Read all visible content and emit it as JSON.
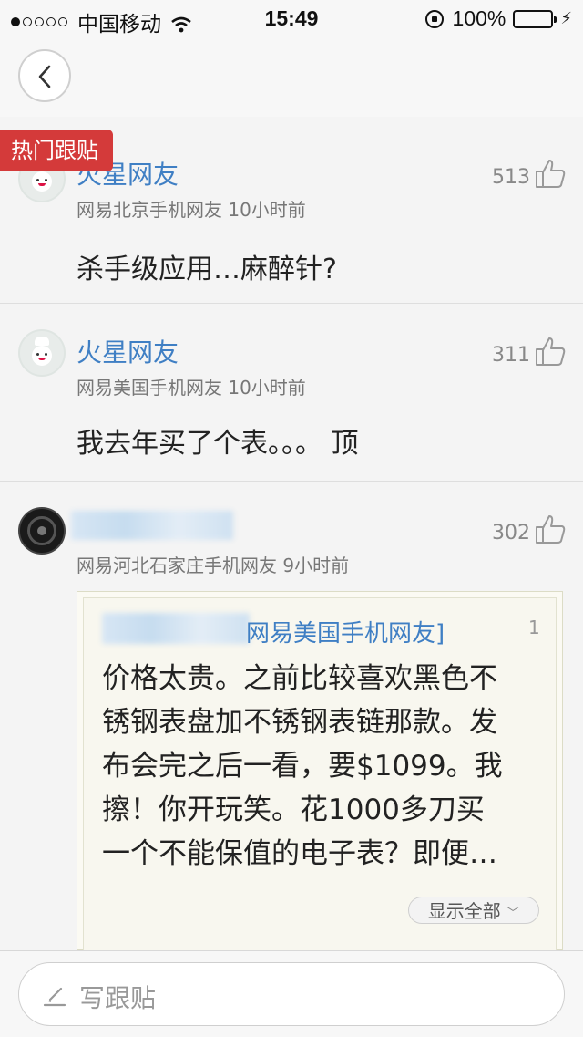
{
  "status_bar": {
    "carrier": "中国移动",
    "time": "15:49",
    "battery": "100%",
    "battery_level": 1.0
  },
  "nav": {
    "back_icon": "chevron-left-icon"
  },
  "hot_tag": "热门跟贴",
  "comments": [
    {
      "name": "火星网友",
      "location": "网易北京手机网友",
      "time": "10小时前",
      "likes": "513",
      "content": "杀手级应用…麻醉针?"
    },
    {
      "name": "火星网友",
      "location": "网易美国手机网友",
      "time": "10小时前",
      "likes": "311",
      "content": "我去年买了个表。。。 顶"
    },
    {
      "name": "",
      "location": "网易河北石家庄手机网友",
      "time": "9小时前",
      "likes": "302",
      "quote": {
        "author": "网易美国手机网友]",
        "floor": "1",
        "lines": [
          "价格太贵。之前比较喜欢黑色不",
          "锈钢表盘加不锈钢表链那款。发",
          "布会完之后一看，要$1099。我",
          "擦！你开玩笑。花1000多刀买",
          "一个不能保值的电子表？即便…"
        ],
        "show_all": "显示全部"
      }
    }
  ],
  "reply": {
    "placeholder": "写跟贴"
  },
  "colors": {
    "accent_blue": "#3f7fc4",
    "hot_tag_red": "#d43a3a",
    "battery_green": "#4cd964"
  }
}
